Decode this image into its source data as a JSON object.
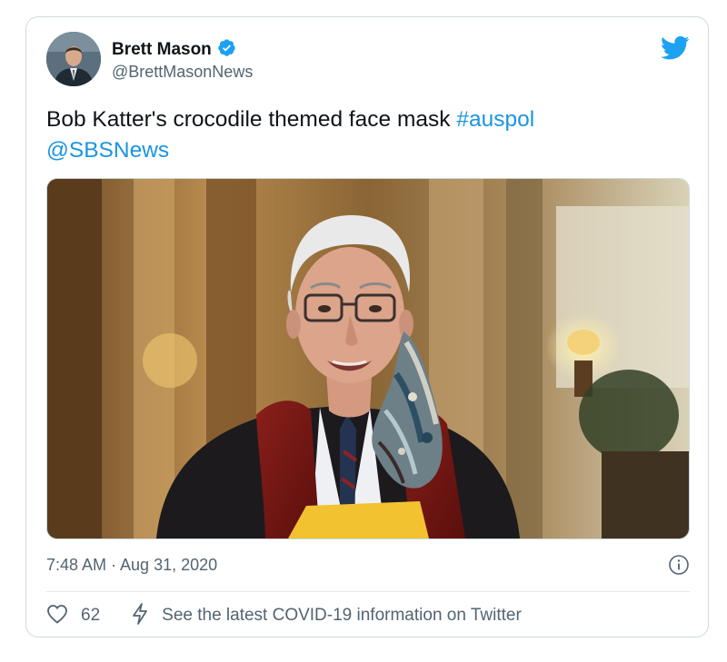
{
  "tweet": {
    "author": {
      "display_name": "Brett Mason",
      "handle": "@BrettMasonNews",
      "verified": true,
      "verified_icon": "verified-badge-icon",
      "avatar_icon": "avatar"
    },
    "text": {
      "body": "Bob Katter's crocodile themed face mask",
      "hashtag": "#auspol",
      "mention": "@SBSNews"
    },
    "media": {
      "type": "photo",
      "icon": "tweet-photo"
    },
    "timestamp": "7:48 AM · Aug 31, 2020",
    "actions": {
      "like_count": "62",
      "like_icon": "heart-icon",
      "covid_text": "See the latest COVID-19 information on Twitter",
      "covid_icon": "lightning-bolt-icon",
      "info_icon": "info-icon"
    },
    "brand_icon": "twitter-bird-icon"
  },
  "colors": {
    "link": "#1b95e0",
    "secondary_text": "#536471",
    "primary_text": "#0f1419",
    "border": "#cfd9de",
    "twitter_blue": "#1da1f2"
  }
}
